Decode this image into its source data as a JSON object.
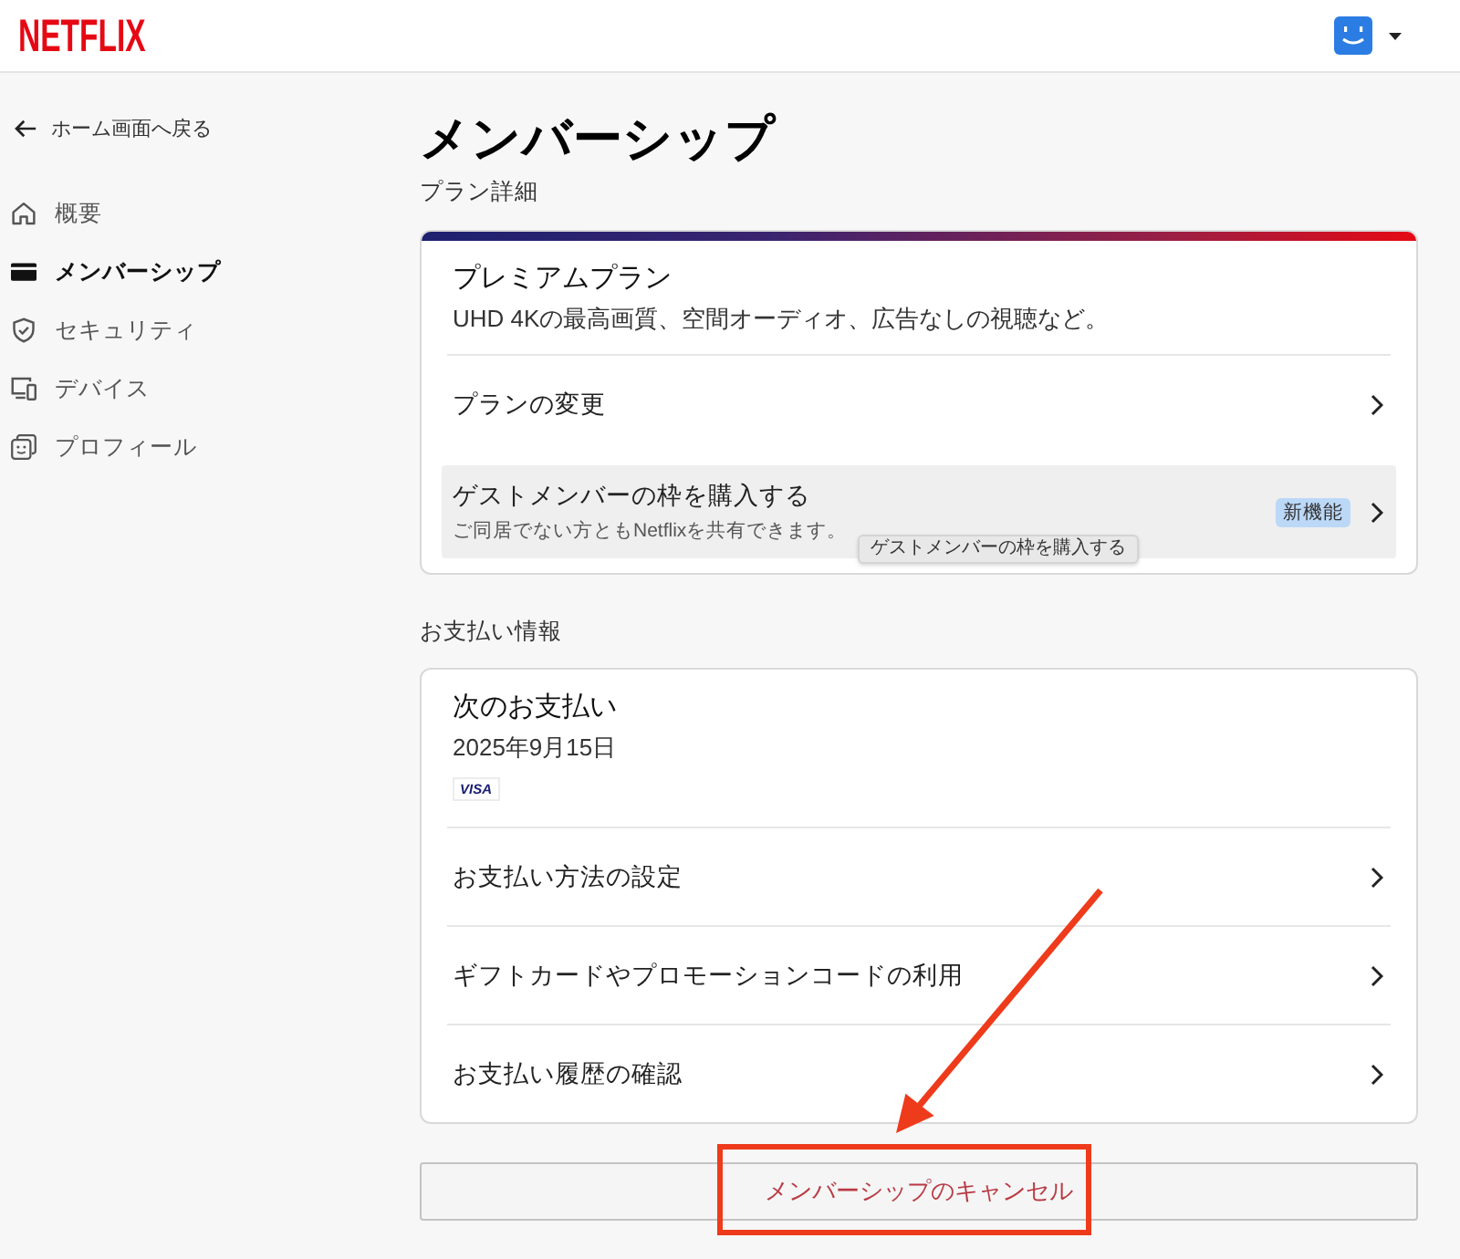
{
  "header": {
    "logo": "NETFLIX"
  },
  "sidebar": {
    "back_link": "ホーム画面へ戻る",
    "items": [
      {
        "kind": "home",
        "label": "概要",
        "selected": false
      },
      {
        "kind": "card",
        "label": "メンバーシップ",
        "selected": true
      },
      {
        "kind": "shield",
        "label": "セキュリティ",
        "selected": false
      },
      {
        "kind": "devices",
        "label": "デバイス",
        "selected": false
      },
      {
        "kind": "profile",
        "label": "プロフィール",
        "selected": false
      }
    ]
  },
  "page": {
    "title": "メンバーシップ"
  },
  "plan_section": {
    "heading": "プラン詳細",
    "plan_name": "プレミアムプラン",
    "description": "UHD 4Kの最高画質、空間オーディオ、広告なしの視聴など。",
    "rows": [
      {
        "label": "プランの変更",
        "hovered": false
      },
      {
        "label": "ゲストメンバーの枠を購入する",
        "description": "ご同居でない方ともNetflixを共有できます。",
        "badge": "新機能",
        "hovered": true,
        "tooltip": "ゲストメンバーの枠を購入する"
      }
    ]
  },
  "payment_section": {
    "heading": "お支払い情報",
    "next_payment_label": "次のお支払い",
    "next_payment_date": "2025年9月15日",
    "card_brand": "VISA",
    "rows": [
      {
        "label": "お支払い方法の設定",
        "hovered": false
      },
      {
        "label": "ギフトカードやプロモーションコードの利用",
        "hovered": false
      },
      {
        "label": "お支払い履歴の確認",
        "hovered": false
      }
    ]
  },
  "cancel_button": {
    "label": "メンバーシップのキャンセル"
  }
}
